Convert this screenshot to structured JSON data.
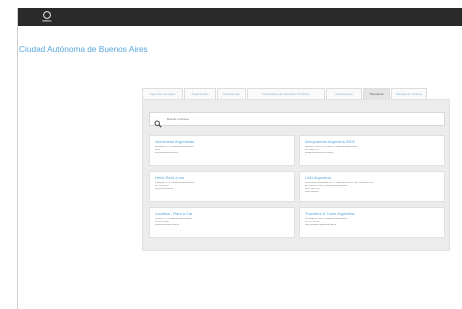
{
  "header": {
    "logo_text": "Ingresar"
  },
  "page": {
    "title": "Ciudad Autónoma de Buenos Aires"
  },
  "tabs": [
    {
      "label": "Agencias de viajes",
      "active": false
    },
    {
      "label": "Alojamientos",
      "active": false
    },
    {
      "label": "Excursiones",
      "active": false
    },
    {
      "label": "Prestadores de Servicios Turísticos",
      "active": false
    },
    {
      "label": "Gastronomía",
      "active": false
    },
    {
      "label": "Transporte",
      "active": true
    },
    {
      "label": "Oficinas de Turismo",
      "active": false
    }
  ],
  "search": {
    "placeholder": "Buscar empresa",
    "value": ""
  },
  "cards": [
    {
      "name": "Aerolíneas Argentinas",
      "lines": [
        "Rivadavia 578, Ciudad de Buenos Aires",
        "0810",
        "info@aerolineas.com.ar"
      ]
    },
    {
      "name": "Aeropuertos Argentina 2000",
      "lines": [
        "Honduras 5673 (C1414BNE), Ciudad de Buenos Aires",
        "011 5480 6111",
        "aeropuertos@aa2000.com.ar"
      ]
    },
    {
      "name": "Hertz Rent a car",
      "lines": [
        "Paraguay 1122, Ciudad de Buenos Aires",
        "011 4816 8001",
        "info@hertz.com.ar"
      ]
    },
    {
      "name": "LAN Argentina",
      "lines": [
        "Cerrito 866 / Esmeralda 1075 / Juana Manso 855 / Av. Corrientes 4901",
        "Av. Santa Fe 2061, Ciudad de Buenos Aires",
        "0810 9999 526",
        "info@lan.com"
      ]
    },
    {
      "name": "Localiza - Rent a Car",
      "lines": [
        "Cerrito 1575, Ciudad de Buenos Aires",
        "011 4816 8001",
        "localiza@localiza.com.ar"
      ]
    },
    {
      "name": "Transfers & Tours Argentina",
      "lines": [
        "Reconquista 1056, Ciudad de Buenos Aires",
        "011 4311 4214",
        "info@transfers-argentina.com.ar"
      ]
    }
  ]
}
